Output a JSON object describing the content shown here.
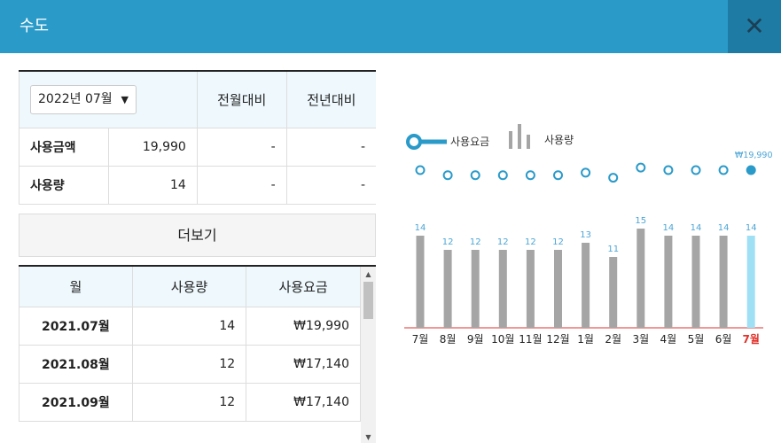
{
  "modal": {
    "title": "수도",
    "close_label": "✕"
  },
  "summary": {
    "selected_month": "2022년 07월",
    "headers": [
      "전월대비",
      "전년대비"
    ],
    "rows": [
      {
        "label": "사용금액",
        "value": "19,990",
        "mom": "-",
        "yoy": "-"
      },
      {
        "label": "사용량",
        "value": "14",
        "mom": "-",
        "yoy": "-"
      }
    ]
  },
  "more_button": "더보기",
  "history": {
    "headers": [
      "월",
      "사용량",
      "사용요금"
    ],
    "rows": [
      {
        "month": "2021.07월",
        "usage": "14",
        "fee": "₩19,990"
      },
      {
        "month": "2021.08월",
        "usage": "12",
        "fee": "₩17,140"
      },
      {
        "month": "2021.09월",
        "usage": "12",
        "fee": "₩17,140"
      }
    ]
  },
  "chart_data": {
    "type": "bar",
    "legend": [
      "사용요금",
      "사용량"
    ],
    "categories": [
      "7월",
      "8월",
      "9월",
      "10월",
      "11월",
      "12월",
      "1월",
      "2월",
      "3월",
      "4월",
      "5월",
      "6월",
      "7월"
    ],
    "series": [
      {
        "name": "사용량",
        "values": [
          14,
          12,
          12,
          12,
          12,
          12,
          13,
          11,
          15,
          14,
          14,
          14,
          14
        ]
      },
      {
        "name": "사용요금",
        "values": [
          19990,
          17140,
          17140,
          17140,
          17140,
          17140,
          18565,
          15715,
          21415,
          19990,
          19990,
          19990,
          19990
        ]
      }
    ],
    "highlight_label": "₩19,990",
    "highlight_index": 12,
    "colors": {
      "bar": "#a5a5a5",
      "bar_highlight": "#9fe0f4",
      "line": "#2a9ac9",
      "highlight_text": "#e0322b",
      "value_label": "#4da6d6",
      "axis": "#e0322b"
    }
  }
}
